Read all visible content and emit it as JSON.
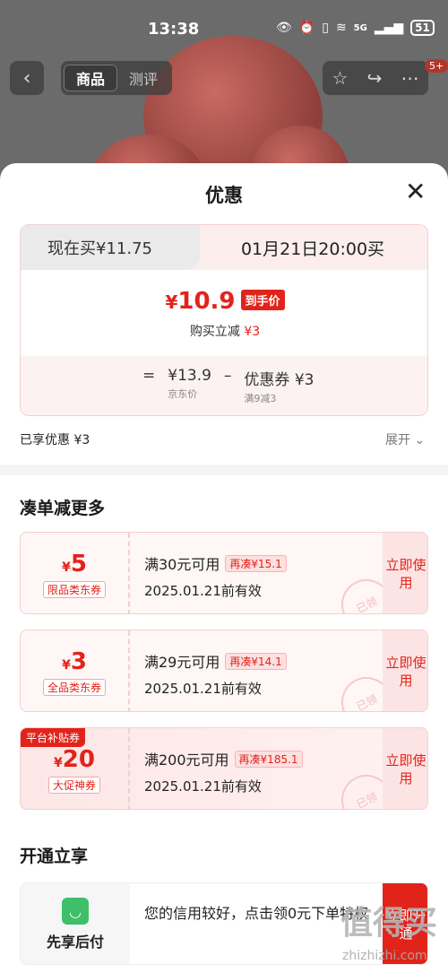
{
  "status": {
    "time": "13:38",
    "battery": "51",
    "network": "5G"
  },
  "topbar": {
    "tabs": [
      {
        "label": "商品"
      },
      {
        "label": "测评"
      }
    ],
    "badge": "5+"
  },
  "sheet": {
    "title": "优惠",
    "price_card": {
      "left_tab": "现在买¥11.75",
      "right_tab": "01月21日20:00买",
      "currency": "¥",
      "final_price": "10.9",
      "final_tag": "到手价",
      "instant_label": "购买立减",
      "instant_value": "¥3",
      "calc": {
        "eq": "=",
        "base": "¥13.9",
        "base_label": "京东价",
        "minus": "–",
        "coupon": "优惠券 ¥3",
        "coupon_label": "满9减3"
      }
    },
    "enjoyed": "已享优惠 ¥3",
    "expand": "展开 ⌄",
    "section_more": "凑单减更多",
    "coupons": [
      {
        "ribbon": "",
        "amount": "5",
        "type": "限品类东券",
        "condition": "满30元可用",
        "tag": "再凑¥15.1",
        "date": "2025.01.21前有效",
        "stamp": "已领",
        "button": "立即使用"
      },
      {
        "ribbon": "",
        "amount": "3",
        "type": "全品类东券",
        "condition": "满29元可用",
        "tag": "再凑¥14.1",
        "date": "2025.01.21前有效",
        "stamp": "已领",
        "button": "立即使用"
      },
      {
        "ribbon": "平台补贴券",
        "amount": "20",
        "type": "大促神券",
        "condition": "满200元可用",
        "tag": "再凑¥185.1",
        "date": "2025.01.21前有效",
        "stamp": "已领",
        "button": "立即使用"
      }
    ],
    "section_open": "开通立享",
    "open_card": {
      "label": "先享后付",
      "text": "您的信用较好，点击领0元下单特权",
      "button": "立即开通"
    }
  },
  "watermark": {
    "main": "值得买",
    "sub": "zhizhizhi.com"
  }
}
